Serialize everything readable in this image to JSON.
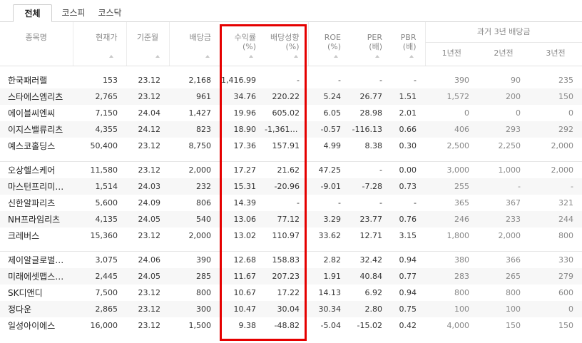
{
  "tabs": [
    "전체",
    "코스피",
    "코스닥"
  ],
  "headers": {
    "name": "종목명",
    "price": "현재가",
    "base": "기준월",
    "dividend": "배당금",
    "yield": [
      "수익률",
      "(%)"
    ],
    "payout": [
      "배당성향",
      "(%)"
    ],
    "roe": [
      "ROE",
      "(%)"
    ],
    "per": [
      "PER",
      "(배)"
    ],
    "pbr": [
      "PBR",
      "(배)"
    ],
    "history_group": "과거 3년 배당금",
    "history": [
      "1년전",
      "2년전",
      "3년전"
    ]
  },
  "groups": [
    [
      [
        "한국패러랠",
        "153",
        "23.12",
        "2,168",
        "1,416.99",
        "-",
        "-",
        "-",
        "-",
        "390",
        "90",
        "235"
      ],
      [
        "스타에스엠리츠",
        "2,765",
        "23.12",
        "961",
        "34.76",
        "220.22",
        "5.24",
        "26.77",
        "1.51",
        "1,572",
        "200",
        "150"
      ],
      [
        "에이블씨엔씨",
        "7,150",
        "24.04",
        "1,427",
        "19.96",
        "605.02",
        "6.05",
        "28.98",
        "2.01",
        "0",
        "0",
        "0"
      ],
      [
        "이지스밸류리츠",
        "4,355",
        "24.12",
        "823",
        "18.90",
        "-1,361.40",
        "-0.57",
        "-116.13",
        "0.66",
        "406",
        "293",
        "292"
      ],
      [
        "예스코홀딩스",
        "50,400",
        "23.12",
        "8,750",
        "17.36",
        "157.91",
        "4.99",
        "8.38",
        "0.30",
        "2,500",
        "2,250",
        "2,000"
      ]
    ],
    [
      [
        "오상헬스케어",
        "11,580",
        "23.12",
        "2,000",
        "17.27",
        "21.62",
        "47.25",
        "-",
        "0.00",
        "3,000",
        "1,000",
        "2,000"
      ],
      [
        "마스턴프리미…",
        "1,514",
        "24.03",
        "232",
        "15.31",
        "-20.96",
        "-9.01",
        "-7.28",
        "0.73",
        "255",
        "-",
        "-"
      ],
      [
        "신한알파리츠",
        "5,600",
        "24.09",
        "806",
        "14.39",
        "-",
        "-",
        "-",
        "-",
        "365",
        "367",
        "321"
      ],
      [
        "NH프라임리츠",
        "4,135",
        "24.05",
        "540",
        "13.06",
        "77.12",
        "3.29",
        "23.77",
        "0.76",
        "246",
        "233",
        "244"
      ],
      [
        "크레버스",
        "15,360",
        "23.12",
        "2,000",
        "13.02",
        "110.97",
        "33.62",
        "12.71",
        "3.15",
        "1,800",
        "2,000",
        "800"
      ]
    ],
    [
      [
        "제이알글로벌…",
        "3,075",
        "24.06",
        "390",
        "12.68",
        "158.83",
        "2.82",
        "32.42",
        "0.94",
        "380",
        "366",
        "330"
      ],
      [
        "미래에셋맵스…",
        "2,445",
        "24.05",
        "285",
        "11.67",
        "207.23",
        "1.91",
        "40.84",
        "0.77",
        "283",
        "265",
        "279"
      ],
      [
        "SK디앤디",
        "7,500",
        "23.12",
        "800",
        "10.67",
        "17.22",
        "14.13",
        "6.92",
        "0.94",
        "800",
        "800",
        "600"
      ],
      [
        "정다운",
        "2,865",
        "23.12",
        "300",
        "10.47",
        "30.04",
        "30.34",
        "2.80",
        "0.75",
        "100",
        "100",
        "0"
      ],
      [
        "일성아이에스",
        "16,000",
        "23.12",
        "1,500",
        "9.38",
        "-48.82",
        "-5.04",
        "-15.02",
        "0.42",
        "4,000",
        "150",
        "150"
      ]
    ]
  ],
  "colors": {
    "highlight": "#e50000",
    "row_alt": "#f7f7f7",
    "header_text": "#888888"
  }
}
